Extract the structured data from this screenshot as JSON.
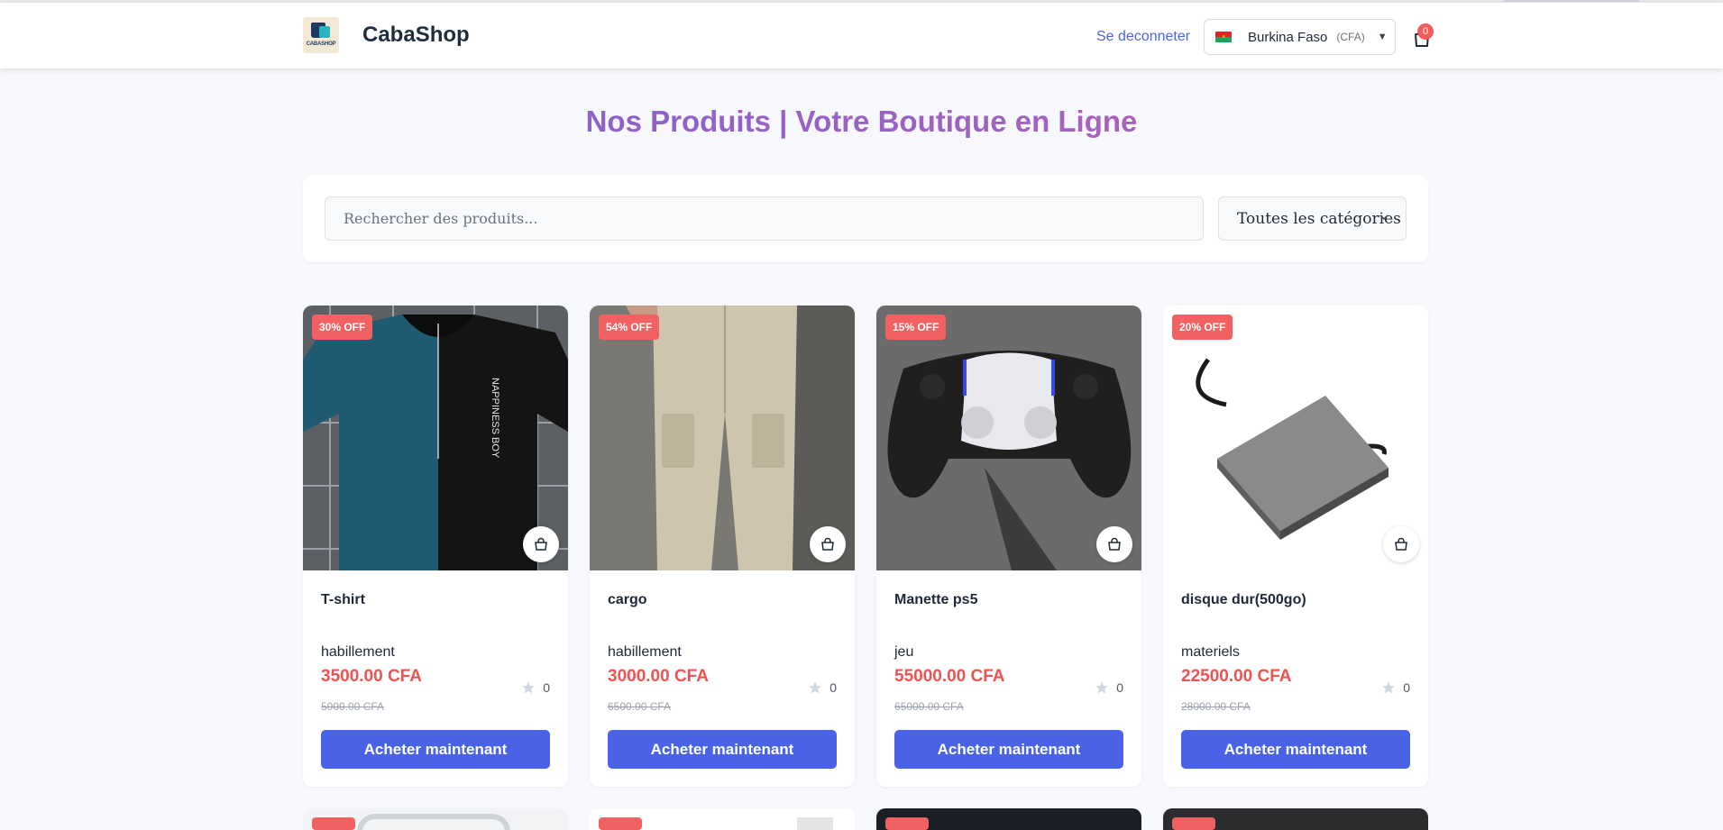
{
  "header": {
    "brand_name": "CabaShop",
    "logo_text": "CABASHOP",
    "logout_label": "Se deconneter",
    "country": "Burkina Faso",
    "currency": "(CFA)",
    "cart_count": "0"
  },
  "page_title": "Nos Produits | Votre Boutique en Ligne",
  "filters": {
    "search_placeholder": "Rechercher des produits...",
    "category_selected": "Toutes les catégories"
  },
  "products": [
    {
      "name": "T-shirt",
      "category": "habillement",
      "price": "3500.00 CFA",
      "old_price": "5000.00 CFA",
      "discount": "30% OFF",
      "rating_count": "0",
      "cta": "Acheter maintenant"
    },
    {
      "name": "cargo",
      "category": "habillement",
      "price": "3000.00 CFA",
      "old_price": "6500.00 CFA",
      "discount": "54% OFF",
      "rating_count": "0",
      "cta": "Acheter maintenant"
    },
    {
      "name": "Manette ps5",
      "category": "jeu",
      "price": "55000.00 CFA",
      "old_price": "65000.00 CFA",
      "discount": "15% OFF",
      "rating_count": "0",
      "cta": "Acheter maintenant"
    },
    {
      "name": "disque dur(500go)",
      "category": "materiels",
      "price": "22500.00 CFA",
      "old_price": "28000.00 CFA",
      "discount": "20% OFF",
      "rating_count": "0",
      "cta": "Acheter maintenant"
    }
  ],
  "colors": {
    "accent": "#4a62e8",
    "price": "#f05252",
    "badge": "#f26161",
    "link": "#4a63e7"
  },
  "icons": {
    "cart": "shopping-bag-icon",
    "quick_add": "bag-icon",
    "rating": "star-icon",
    "dropdown": "chevron-down-icon"
  }
}
